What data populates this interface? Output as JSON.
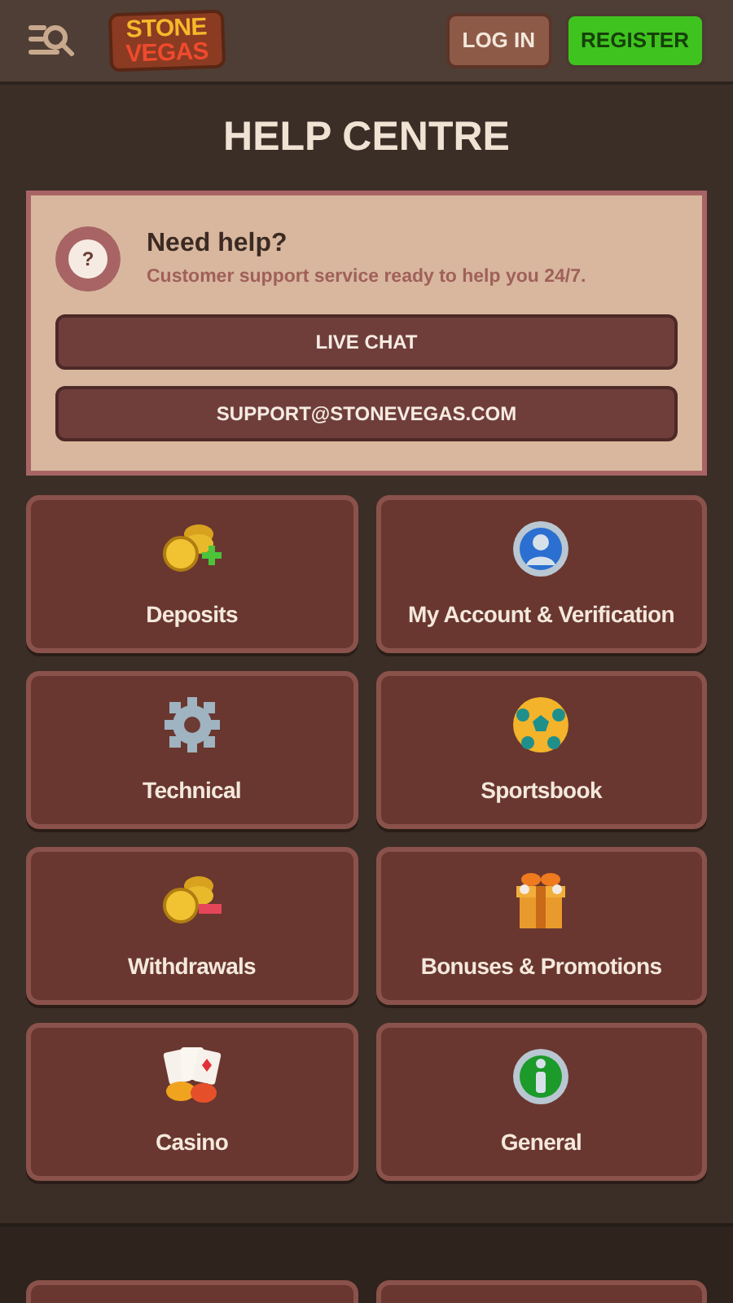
{
  "header": {
    "logo": [
      "STONE",
      "VEGAS"
    ],
    "login_button": "LOG IN",
    "register_button": "REGISTER"
  },
  "title": "HELP CENTRE",
  "help_card": {
    "heading": "Need help?",
    "icon_text": "?",
    "subtitle": "Customer support service ready to help you 24/7.",
    "buttons": [
      "LIVE CHAT",
      "SUPPORT@STONEVEGAS.COM"
    ]
  },
  "categories": [
    {
      "label": "Deposits"
    },
    {
      "label": "My Account & Verification"
    },
    {
      "label": "Technical"
    },
    {
      "label": "Sportsbook"
    },
    {
      "label": "Withdrawals"
    },
    {
      "label": "Bonuses & Promotions"
    },
    {
      "label": "Casino"
    },
    {
      "label": "General"
    }
  ]
}
